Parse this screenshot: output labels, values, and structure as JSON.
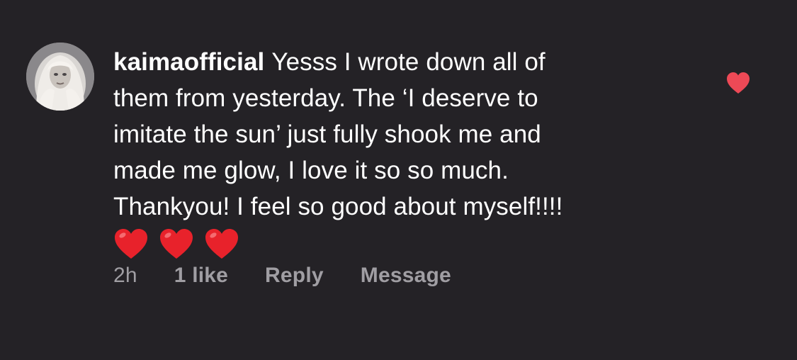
{
  "comment": {
    "username": "kaimaofficial",
    "text_lines": [
      "Yesss I wrote down all of",
      "them from yesterday. The ‘I deserve to",
      "imitate the sun’ just fully shook me and",
      "made me glow, I love it so so much.",
      "Thankyou! I feel so good about myself!!!!"
    ],
    "emojis": [
      "❤️",
      "❤️",
      "❤️"
    ],
    "timestamp": "2h",
    "like_count": "1 like",
    "reply_label": "Reply",
    "message_label": "Message",
    "liked": true
  },
  "icons": {
    "avatar": "user-avatar",
    "like": "heart-icon",
    "emoji": "red-heart-emoji"
  },
  "colors": {
    "background": "#242226",
    "text": "#ffffff",
    "meta_text": "#a09ea3",
    "like_heart": "#ed4956",
    "emoji_heart": "#e8222b"
  }
}
